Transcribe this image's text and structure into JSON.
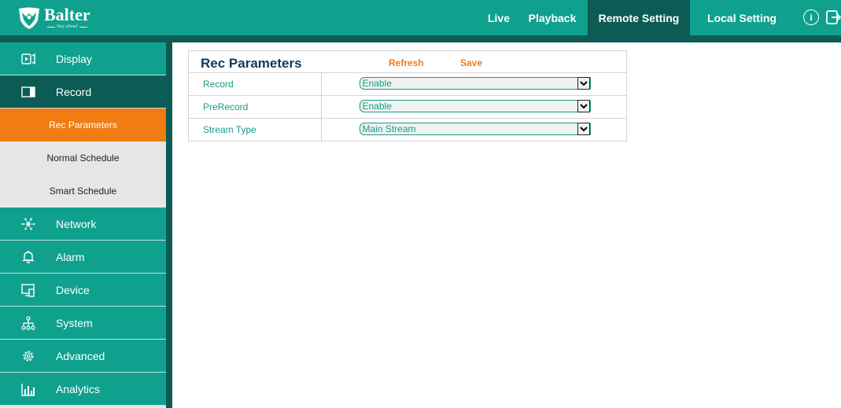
{
  "header": {
    "brand_name": "Balter",
    "brand_tagline": "Stay ahead",
    "nav": [
      {
        "label": "Live"
      },
      {
        "label": "Playback"
      },
      {
        "label": "Remote Setting",
        "active": true
      },
      {
        "label": "Local Setting"
      }
    ],
    "info_glyph": "i",
    "icons": [
      "info-icon",
      "logout-icon"
    ]
  },
  "sidebar": {
    "items": [
      {
        "label": "Display",
        "icon": "display-icon"
      },
      {
        "label": "Record",
        "icon": "record-icon",
        "expanded": true,
        "children": [
          {
            "label": "Rec Parameters",
            "active": true
          },
          {
            "label": "Normal Schedule"
          },
          {
            "label": "Smart Schedule"
          }
        ]
      },
      {
        "label": "Network",
        "icon": "network-icon"
      },
      {
        "label": "Alarm",
        "icon": "bell-icon"
      },
      {
        "label": "Device",
        "icon": "device-icon"
      },
      {
        "label": "System",
        "icon": "system-icon"
      },
      {
        "label": "Advanced",
        "icon": "gear-icon"
      },
      {
        "label": "Analytics",
        "icon": "bar-chart-icon"
      }
    ]
  },
  "panel": {
    "title": "Rec Parameters",
    "refresh_label": "Refresh",
    "save_label": "Save",
    "rows": [
      {
        "label": "Record",
        "value": "Enable"
      },
      {
        "label": "PreRecord",
        "value": "Enable"
      },
      {
        "label": "Stream Type",
        "value": "Main Stream"
      }
    ]
  },
  "colors": {
    "teal": "#0fa18e",
    "dark_teal": "#0c5b55",
    "accent_orange": "#f07c12",
    "title_navy": "#103b5a"
  }
}
